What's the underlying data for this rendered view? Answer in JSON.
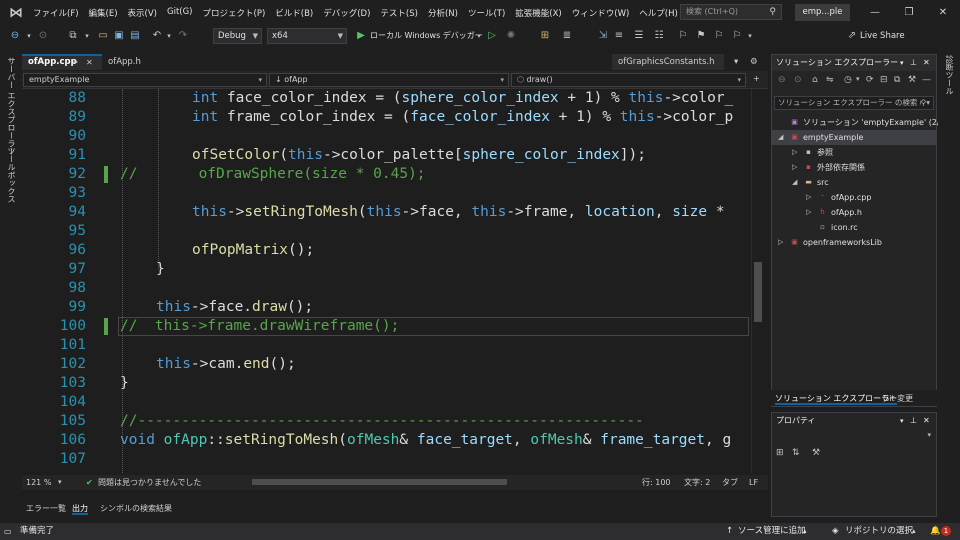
{
  "menu": {
    "items": [
      "ファイル(F)",
      "編集(E)",
      "表示(V)",
      "Git(G)",
      "プロジェクト(P)",
      "ビルド(B)",
      "デバッグ(D)",
      "テスト(S)",
      "分析(N)",
      "ツール(T)",
      "拡張機能(X)",
      "ウィンドウ(W)",
      "ヘルプ(H)"
    ],
    "search_placeholder": "検索 (Ctrl+Q)",
    "title_tab": "emp...ple"
  },
  "toolbar": {
    "config": "Debug",
    "platform": "x64",
    "run_label": "ローカル Windows デバッガー",
    "live_share": "Live Share"
  },
  "left_strip": {
    "server_explorer": "サーバー エクスプローラー",
    "toolbox": "ツールボックス"
  },
  "right_strip": {
    "diagnostics": "診断ツール"
  },
  "doc_tabs": {
    "active": "ofApp.cpp",
    "second": "ofApp.h",
    "right": "ofGraphicsConstants.h"
  },
  "navbar": {
    "project": "emptyExample",
    "scope": "ofApp",
    "member": "draw()"
  },
  "code_lines": [
    {
      "n": "88",
      "tokens": [
        [
          "kw",
          "int "
        ],
        [
          "",
          "face_color_index = ("
        ],
        [
          "vr",
          "sphere_color_index"
        ],
        [
          "",
          " + 1) % "
        ],
        [
          "kw",
          "this"
        ],
        [
          "",
          "->color_"
        ]
      ]
    },
    {
      "n": "89",
      "tokens": [
        [
          "kw",
          "int "
        ],
        [
          "",
          "frame_color_index = ("
        ],
        [
          "vr",
          "face_color_index"
        ],
        [
          "",
          " + 1) % "
        ],
        [
          "kw",
          "this"
        ],
        [
          "",
          "->color_p"
        ]
      ]
    },
    {
      "n": "90",
      "tokens": []
    },
    {
      "n": "91",
      "tokens": [
        [
          "fn",
          "ofSetColor"
        ],
        [
          "",
          "("
        ],
        [
          "kw",
          "this"
        ],
        [
          "",
          "->color_palette["
        ],
        [
          "vr",
          "sphere_color_index"
        ],
        [
          "",
          "]);"
        ]
      ]
    },
    {
      "n": "92",
      "tokens": [
        [
          "cm",
          "//       ofDrawSphere(size * 0.45);"
        ]
      ]
    },
    {
      "n": "93",
      "tokens": []
    },
    {
      "n": "94",
      "tokens": [
        [
          "kw",
          "this"
        ],
        [
          "",
          "->"
        ],
        [
          "fn",
          "setRingToMesh"
        ],
        [
          "",
          "("
        ],
        [
          "kw",
          "this"
        ],
        [
          "",
          "->face, "
        ],
        [
          "kw",
          "this"
        ],
        [
          "",
          "->frame, "
        ],
        [
          "vr",
          "location"
        ],
        [
          "",
          ", "
        ],
        [
          "vr",
          "size"
        ],
        [
          "",
          " *"
        ]
      ]
    },
    {
      "n": "95",
      "tokens": []
    },
    {
      "n": "96",
      "tokens": [
        [
          "fn",
          "ofPopMatrix"
        ],
        [
          "",
          "();"
        ]
      ]
    },
    {
      "n": "97",
      "tokens": [
        [
          "",
          "}"
        ]
      ]
    },
    {
      "n": "98",
      "tokens": []
    },
    {
      "n": "99",
      "tokens": [
        [
          "kw",
          "this"
        ],
        [
          "",
          "->face."
        ],
        [
          "fn",
          "draw"
        ],
        [
          "",
          "();"
        ]
      ]
    },
    {
      "n": "100",
      "tokens": [
        [
          "cm",
          "//  this->frame.drawWireframe();"
        ]
      ]
    },
    {
      "n": "101",
      "tokens": []
    },
    {
      "n": "102",
      "tokens": [
        [
          "kw",
          "this"
        ],
        [
          "",
          "->cam."
        ],
        [
          "fn",
          "end"
        ],
        [
          "",
          "();"
        ]
      ]
    },
    {
      "n": "103",
      "tokens": [
        [
          "",
          "}"
        ]
      ]
    },
    {
      "n": "104",
      "tokens": []
    },
    {
      "n": "105",
      "tokens": [
        [
          "cm",
          "//----------------------------------------------------------"
        ]
      ]
    },
    {
      "n": "106",
      "tokens": [
        [
          "kw",
          "void "
        ],
        [
          "ty",
          "ofApp"
        ],
        [
          "",
          "::"
        ],
        [
          "fn",
          "setRingToMesh"
        ],
        [
          "",
          "("
        ],
        [
          "ty",
          "ofMesh"
        ],
        [
          "",
          "& "
        ],
        [
          "vr",
          "face_target"
        ],
        [
          "",
          ", "
        ],
        [
          "ty",
          "ofMesh"
        ],
        [
          "",
          "& "
        ],
        [
          "vr",
          "frame_target"
        ],
        [
          "",
          ", g"
        ]
      ]
    },
    {
      "n": "107",
      "tokens": []
    }
  ],
  "editor_status": {
    "zoom": "121 %",
    "issues": "問題は見つかりませんでした",
    "line": "行: 100",
    "col": "文字: 2",
    "tab": "タブ",
    "eol": "LF"
  },
  "bottom_tabs": [
    "エラー一覧",
    "出力",
    "シンボルの検索結果"
  ],
  "statusbar": {
    "ready": "準備完了",
    "source_control": "ソース管理に追加",
    "repo": "リポジトリの選択",
    "notif_count": "1"
  },
  "solution_explorer": {
    "title": "ソリューション エクスプローラー",
    "search_placeholder": "ソリューション エクスプローラー の検索 (",
    "tree": [
      {
        "label": "ソリューション 'emptyExample' (2/2 プ",
        "level": 0,
        "arrow": "",
        "icon": "solution"
      },
      {
        "label": "emptyExample",
        "level": 0,
        "arrow": "◢",
        "icon": "project",
        "selected": true
      },
      {
        "label": "参照",
        "level": 1,
        "arrow": "▷",
        "icon": "references"
      },
      {
        "label": "外部依存関係",
        "level": 1,
        "arrow": "▷",
        "icon": "external"
      },
      {
        "label": "src",
        "level": 1,
        "arrow": "◢",
        "icon": "folder"
      },
      {
        "label": "ofApp.cpp",
        "level": 2,
        "arrow": "▷",
        "icon": "cpp"
      },
      {
        "label": "ofApp.h",
        "level": 2,
        "arrow": "▷",
        "icon": "header"
      },
      {
        "label": "icon.rc",
        "level": 2,
        "arrow": "",
        "icon": "resource"
      },
      {
        "label": "openframeworksLib",
        "level": 0,
        "arrow": "▷",
        "icon": "project"
      }
    ],
    "tabs": [
      "ソリューション エクスプローラー",
      "Git 変更"
    ]
  },
  "properties": {
    "title": "プロパティ"
  }
}
